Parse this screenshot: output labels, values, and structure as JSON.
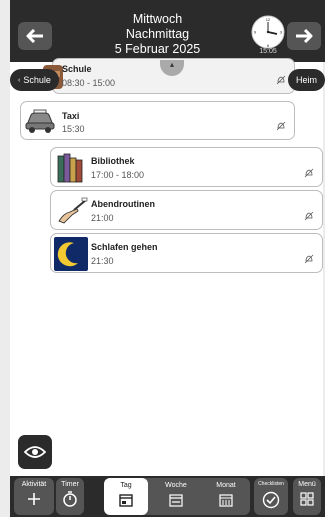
{
  "header": {
    "weekday": "Mittwoch",
    "daypart": "Nachmittag",
    "date": "5 Februar 2025",
    "clock_time": "15:05",
    "prev_icon": "arrow-left-icon",
    "next_icon": "arrow-right-icon"
  },
  "nav_pills": {
    "left": "Schule",
    "right": "Heim"
  },
  "activities": [
    {
      "name": "Schule",
      "time": "08:30 - 15:00",
      "icon": "school-bag-icon"
    },
    {
      "name": "Taxi",
      "time": "15:30",
      "icon": "taxi-icon"
    },
    {
      "name": "Bibliothek",
      "time": "17:00 - 18:00",
      "icon": "books-icon"
    },
    {
      "name": "Abendroutinen",
      "time": "21:00",
      "icon": "hand-toothbrush-icon"
    },
    {
      "name": "Schlafen gehen",
      "time": "21:30",
      "icon": "moon-icon"
    }
  ],
  "footer": {
    "add_activity": "Aktivität",
    "timer": "Timer",
    "tabs": [
      "Tag",
      "Woche",
      "Monat"
    ],
    "active_tab": "Tag",
    "checklist": "Checklisten",
    "menu": "Menü"
  },
  "colors": {
    "dark": "#2b2b2b",
    "button_gray": "#555555",
    "card_border": "#bdbdbd"
  }
}
